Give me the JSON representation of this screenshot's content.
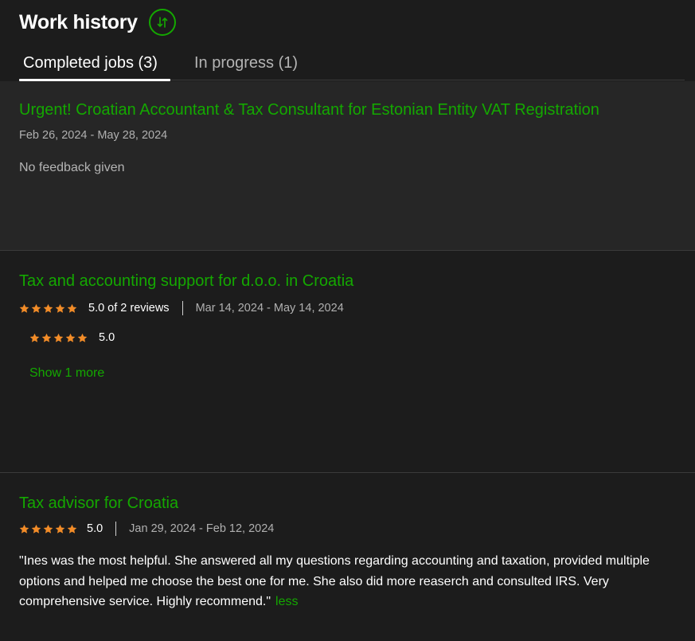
{
  "header": {
    "title": "Work history",
    "sort_icon": "sort-arrows-icon"
  },
  "tabs": [
    {
      "label": "Completed jobs (3)",
      "active": true
    },
    {
      "label": "In progress (1)",
      "active": false
    }
  ],
  "colors": {
    "accent": "#14a800",
    "star": "#f28c28",
    "background": "#1c1c1c",
    "highlight": "#262626"
  },
  "jobs": [
    {
      "title": "Urgent! Croatian Accountant & Tax Consultant for Estonian Entity VAT Registration",
      "dates": "Feb 26, 2024 - May 28, 2024",
      "feedback": "No feedback given"
    },
    {
      "title": "Tax and accounting support for d.o.o. in Croatia",
      "rating": 5,
      "rating_text": "5.0 of 2 reviews",
      "dates": "Mar 14, 2024 - May 14, 2024",
      "sub_rating": 5,
      "sub_rating_text": "5.0",
      "show_more": "Show 1 more"
    },
    {
      "title": "Tax advisor for Croatia",
      "rating": 5,
      "rating_text": "5.0",
      "dates": "Jan 29, 2024 - Feb 12, 2024",
      "review": "\"Ines was the most helpful. She answered all my questions regarding accounting and taxation, provided multiple options and helped me choose the best one for me. She also did more reaserch and consulted IRS. Very comprehensive service. Highly recommend.\"",
      "less_label": "less"
    }
  ]
}
